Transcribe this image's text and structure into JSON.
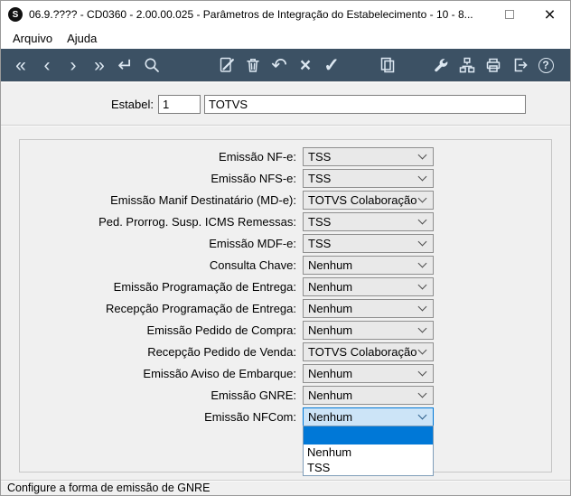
{
  "window": {
    "title": "06.9.???? - CD0360 - 2.00.00.025 - Parâmetros de Integração do Estabelecimento - 10 - 8...",
    "logo_letter": "S",
    "close_glyph": "×"
  },
  "menu": {
    "items": [
      {
        "label": "Arquivo"
      },
      {
        "label": "Ajuda"
      }
    ]
  },
  "toolbar": {
    "glyphs": {
      "first": "«",
      "previous": "‹",
      "next": "›",
      "last": "»",
      "go": "↵",
      "undo": "↶",
      "cancel": "×",
      "confirm": "✓",
      "help": "?"
    },
    "icons": [
      "first-record",
      "previous-record",
      "next-record",
      "last-record",
      "go-to",
      "search",
      "edit-document",
      "delete",
      "undo",
      "cancel",
      "confirm",
      "copy",
      "tools",
      "integration",
      "print",
      "exit",
      "help"
    ]
  },
  "form": {
    "estabel_label": "Estabel:",
    "estabel_code": "1",
    "estabel_name": "TOTVS"
  },
  "fields": [
    {
      "label": "Emissão NF-e:",
      "value": "TSS"
    },
    {
      "label": "Emissão NFS-e:",
      "value": "TSS"
    },
    {
      "label": "Emissão Manif Destinatário (MD-e):",
      "value": "TOTVS Colaboração"
    },
    {
      "label": "Ped. Prorrog. Susp. ICMS Remessas:",
      "value": "TSS"
    },
    {
      "label": "Emissão MDF-e:",
      "value": "TSS"
    },
    {
      "label": "Consulta Chave:",
      "value": "Nenhum"
    },
    {
      "label": "Emissão Programação de Entrega:",
      "value": "Nenhum"
    },
    {
      "label": "Recepção Programação de Entrega:",
      "value": "Nenhum"
    },
    {
      "label": "Emissão Pedido de Compra:",
      "value": "Nenhum"
    },
    {
      "label": "Recepção Pedido de Venda:",
      "value": "TOTVS Colaboração"
    },
    {
      "label": "Emissão Aviso de Embarque:",
      "value": "Nenhum"
    },
    {
      "label": "Emissão GNRE:",
      "value": "Nenhum"
    },
    {
      "label": "Emissão NFCom:",
      "value": "Nenhum"
    }
  ],
  "dropdown": {
    "items": [
      "",
      "Nenhum",
      "TSS"
    ],
    "highlighted_index": 0
  },
  "statusbar": {
    "text": "Configure a forma de emissão de GNRE"
  },
  "colors": {
    "toolbar_bg": "#3c5164",
    "accent": "#0078d7",
    "combo_bg": "#e9e9e9",
    "combo_open_bg": "#cce4f7",
    "window_bg": "#f0f0f0"
  }
}
